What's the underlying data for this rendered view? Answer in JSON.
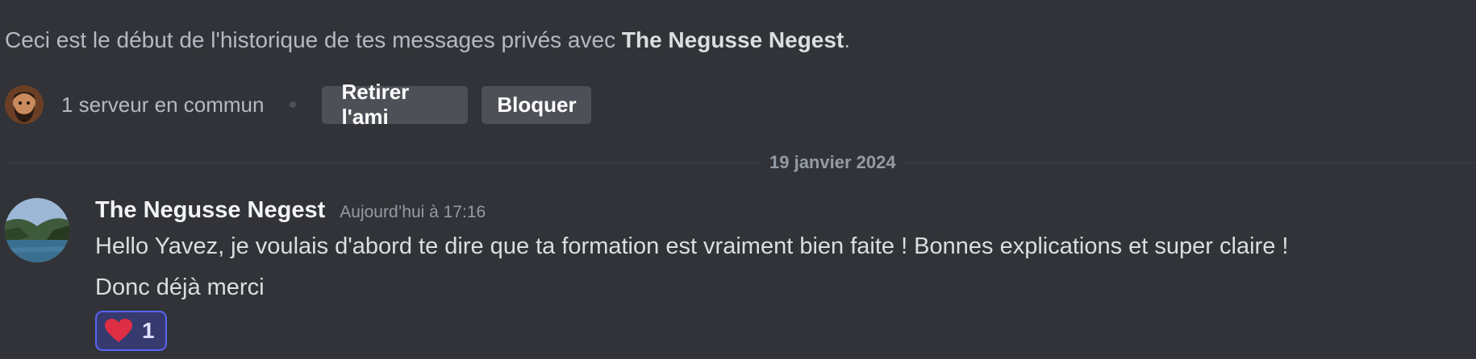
{
  "intro": {
    "prefix": "Ceci est le début de l'historique de tes messages privés avec ",
    "username": "The Negusse Negest",
    "suffix": "."
  },
  "profile_actions": {
    "mutual_servers": "1 serveur en commun",
    "remove_friend_label": "Retirer l'ami",
    "block_label": "Bloquer"
  },
  "date_divider": "19 janvier 2024",
  "message": {
    "author": "The Negusse Negest",
    "timestamp": "Aujourd’hui à 17:16",
    "lines": [
      "Hello Yavez, je voulais d'abord te dire que ta formation est vraiment bien faite ! Bonnes explications et super claire !",
      "Donc déjà merci"
    ],
    "reaction": {
      "emoji": "heart-icon",
      "count": "1"
    }
  },
  "colors": {
    "background": "#313338",
    "button": "#4e5058",
    "reaction_border": "#5865f2",
    "reaction_bg": "#373a6f",
    "heart": "#dd2e44"
  }
}
